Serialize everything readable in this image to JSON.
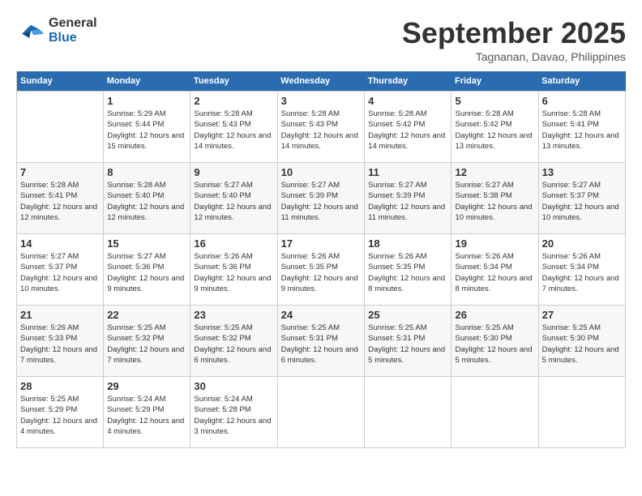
{
  "header": {
    "logo_line1": "General",
    "logo_line2": "Blue",
    "month": "September 2025",
    "location": "Tagnanan, Davao, Philippines"
  },
  "weekdays": [
    "Sunday",
    "Monday",
    "Tuesday",
    "Wednesday",
    "Thursday",
    "Friday",
    "Saturday"
  ],
  "weeks": [
    [
      {
        "day": "",
        "info": ""
      },
      {
        "day": "1",
        "info": "Sunrise: 5:29 AM\nSunset: 5:44 PM\nDaylight: 12 hours\nand 15 minutes."
      },
      {
        "day": "2",
        "info": "Sunrise: 5:28 AM\nSunset: 5:43 PM\nDaylight: 12 hours\nand 14 minutes."
      },
      {
        "day": "3",
        "info": "Sunrise: 5:28 AM\nSunset: 5:43 PM\nDaylight: 12 hours\nand 14 minutes."
      },
      {
        "day": "4",
        "info": "Sunrise: 5:28 AM\nSunset: 5:42 PM\nDaylight: 12 hours\nand 14 minutes."
      },
      {
        "day": "5",
        "info": "Sunrise: 5:28 AM\nSunset: 5:42 PM\nDaylight: 12 hours\nand 13 minutes."
      },
      {
        "day": "6",
        "info": "Sunrise: 5:28 AM\nSunset: 5:41 PM\nDaylight: 12 hours\nand 13 minutes."
      }
    ],
    [
      {
        "day": "7",
        "info": "Sunrise: 5:28 AM\nSunset: 5:41 PM\nDaylight: 12 hours\nand 12 minutes."
      },
      {
        "day": "8",
        "info": "Sunrise: 5:28 AM\nSunset: 5:40 PM\nDaylight: 12 hours\nand 12 minutes."
      },
      {
        "day": "9",
        "info": "Sunrise: 5:27 AM\nSunset: 5:40 PM\nDaylight: 12 hours\nand 12 minutes."
      },
      {
        "day": "10",
        "info": "Sunrise: 5:27 AM\nSunset: 5:39 PM\nDaylight: 12 hours\nand 11 minutes."
      },
      {
        "day": "11",
        "info": "Sunrise: 5:27 AM\nSunset: 5:39 PM\nDaylight: 12 hours\nand 11 minutes."
      },
      {
        "day": "12",
        "info": "Sunrise: 5:27 AM\nSunset: 5:38 PM\nDaylight: 12 hours\nand 10 minutes."
      },
      {
        "day": "13",
        "info": "Sunrise: 5:27 AM\nSunset: 5:37 PM\nDaylight: 12 hours\nand 10 minutes."
      }
    ],
    [
      {
        "day": "14",
        "info": "Sunrise: 5:27 AM\nSunset: 5:37 PM\nDaylight: 12 hours\nand 10 minutes."
      },
      {
        "day": "15",
        "info": "Sunrise: 5:27 AM\nSunset: 5:36 PM\nDaylight: 12 hours\nand 9 minutes."
      },
      {
        "day": "16",
        "info": "Sunrise: 5:26 AM\nSunset: 5:36 PM\nDaylight: 12 hours\nand 9 minutes."
      },
      {
        "day": "17",
        "info": "Sunrise: 5:26 AM\nSunset: 5:35 PM\nDaylight: 12 hours\nand 9 minutes."
      },
      {
        "day": "18",
        "info": "Sunrise: 5:26 AM\nSunset: 5:35 PM\nDaylight: 12 hours\nand 8 minutes."
      },
      {
        "day": "19",
        "info": "Sunrise: 5:26 AM\nSunset: 5:34 PM\nDaylight: 12 hours\nand 8 minutes."
      },
      {
        "day": "20",
        "info": "Sunrise: 5:26 AM\nSunset: 5:34 PM\nDaylight: 12 hours\nand 7 minutes."
      }
    ],
    [
      {
        "day": "21",
        "info": "Sunrise: 5:26 AM\nSunset: 5:33 PM\nDaylight: 12 hours\nand 7 minutes."
      },
      {
        "day": "22",
        "info": "Sunrise: 5:25 AM\nSunset: 5:32 PM\nDaylight: 12 hours\nand 7 minutes."
      },
      {
        "day": "23",
        "info": "Sunrise: 5:25 AM\nSunset: 5:32 PM\nDaylight: 12 hours\nand 6 minutes."
      },
      {
        "day": "24",
        "info": "Sunrise: 5:25 AM\nSunset: 5:31 PM\nDaylight: 12 hours\nand 6 minutes."
      },
      {
        "day": "25",
        "info": "Sunrise: 5:25 AM\nSunset: 5:31 PM\nDaylight: 12 hours\nand 5 minutes."
      },
      {
        "day": "26",
        "info": "Sunrise: 5:25 AM\nSunset: 5:30 PM\nDaylight: 12 hours\nand 5 minutes."
      },
      {
        "day": "27",
        "info": "Sunrise: 5:25 AM\nSunset: 5:30 PM\nDaylight: 12 hours\nand 5 minutes."
      }
    ],
    [
      {
        "day": "28",
        "info": "Sunrise: 5:25 AM\nSunset: 5:29 PM\nDaylight: 12 hours\nand 4 minutes."
      },
      {
        "day": "29",
        "info": "Sunrise: 5:24 AM\nSunset: 5:29 PM\nDaylight: 12 hours\nand 4 minutes."
      },
      {
        "day": "30",
        "info": "Sunrise: 5:24 AM\nSunset: 5:28 PM\nDaylight: 12 hours\nand 3 minutes."
      },
      {
        "day": "",
        "info": ""
      },
      {
        "day": "",
        "info": ""
      },
      {
        "day": "",
        "info": ""
      },
      {
        "day": "",
        "info": ""
      }
    ]
  ]
}
